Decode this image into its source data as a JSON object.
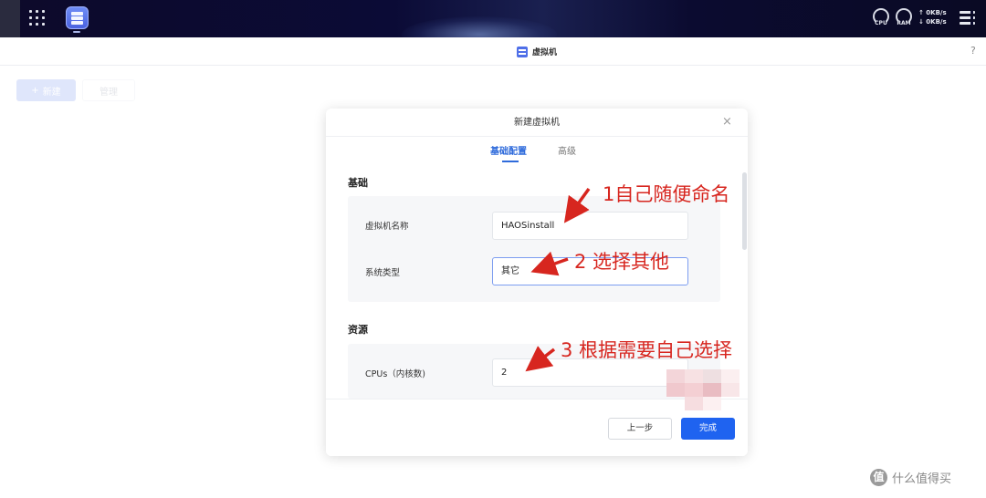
{
  "taskbar": {
    "gauges": [
      {
        "label": "CPU",
        "icon": "cpu-gauge-icon"
      },
      {
        "label": "RAM",
        "icon": "ram-gauge-icon"
      }
    ],
    "network": {
      "upload": "↑ 0KB/s",
      "download": "↓ 0KB/s"
    }
  },
  "window": {
    "title": "虚拟机",
    "help": "?"
  },
  "toolbar": {
    "new_label": "新建",
    "new_icon_glyph": "+",
    "manage_label": "管理"
  },
  "dialog": {
    "title": "新建虚拟机",
    "close_glyph": "×",
    "tabs": [
      {
        "label": "基础配置",
        "active": true
      },
      {
        "label": "高级",
        "active": false
      }
    ],
    "sections": {
      "basic": {
        "title": "基础",
        "fields": [
          {
            "label": "虚拟机名称",
            "value": "HAOSinstall"
          },
          {
            "label": "系统类型",
            "value": "其它"
          }
        ]
      },
      "resources": {
        "title": "资源",
        "fields": [
          {
            "label": "CPUs（内核数)",
            "value": "2"
          }
        ]
      }
    },
    "footer": {
      "prev_label": "上一步",
      "done_label": "完成"
    }
  },
  "annotations": [
    "1自己随便命名",
    "2 选择其他",
    "3 根据需要自己选择"
  ],
  "colors": {
    "accent": "#1f63f0",
    "annotation": "#d7261f",
    "taskbar_bg": "#0b0b30"
  },
  "watermark": {
    "logo_glyph": "值",
    "text": "什么值得买"
  }
}
